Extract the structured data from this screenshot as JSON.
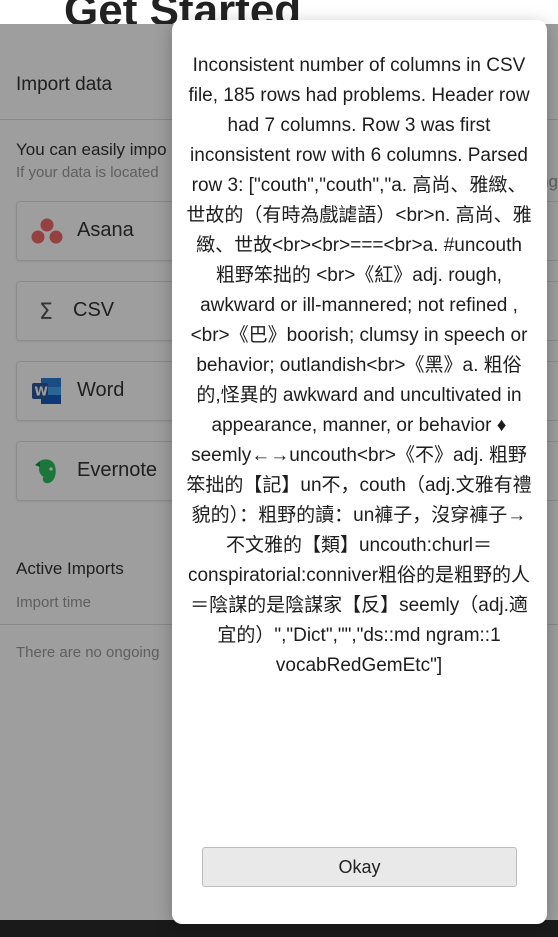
{
  "background": {
    "page_title": "Get Started",
    "import_panel": {
      "title": "Import data",
      "description": "You can easily impo",
      "sub_description": "If your data is located",
      "right_fragment": "n",
      "sources": [
        {
          "label": "Asana",
          "icon": "asana-icon"
        },
        {
          "label": "CSV",
          "icon": "sigma-icon"
        },
        {
          "label": "Word",
          "icon": "word-icon"
        },
        {
          "label": "Evernote",
          "icon": "evernote-icon"
        }
      ],
      "active_imports_title": "Active Imports",
      "import_time_header": "Import time",
      "no_imports_text": "There are no ongoing"
    }
  },
  "modal": {
    "message": "Inconsistent number of columns in CSV file, 185 rows had problems. Header row had 7 columns. Row 3 was first inconsistent row with 6 columns. Parsed row 3: [\"couth\",\"couth\",\"a. 高尚、雅緻、世故的（有時為戲謔語）<br>n. 高尚、雅緻、世故<br><br>===<br>a. #uncouth 粗野笨拙的 <br>《紅》adj. rough, awkward or ill-mannered; not refined ,<br>《巴》boorish; clumsy in speech or behavior; outlandish<br>《黑》a. 粗俗的,怪異的 awkward and uncultivated in appearance, manner, or behavior ♦ seemly←→uncouth<br>《不》adj. 粗野笨拙的【記】un不，couth（adj.文雅有禮貌的）：粗野的讀：un褲子，沒穿褲子→不文雅的【類】uncouth:churl＝conspiratorial:conniver粗俗的是粗野的人＝陰謀的是陰謀家【反】seemly（adj.適宜的）\",\"Dict\",\"\",\"ds::md ngram::1 vocabRedGemEtc\"]",
    "okay_label": "Okay"
  },
  "colors": {
    "asana": "#f06a6a",
    "word": "#2b579a",
    "evernote": "#2dbe60",
    "overlay": "rgba(0,0,0,0.38)"
  }
}
